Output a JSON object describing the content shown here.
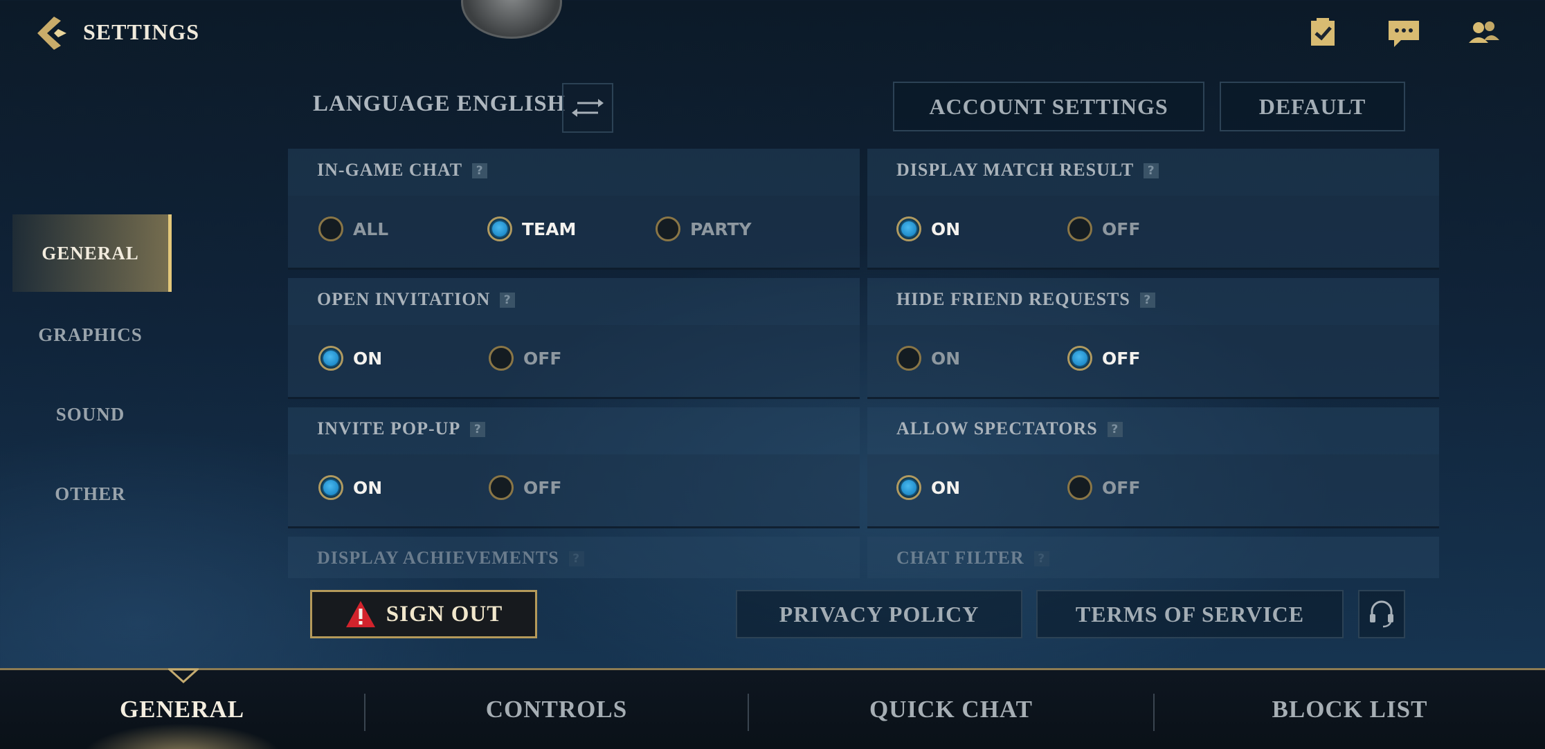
{
  "header": {
    "title": "SETTINGS"
  },
  "language": {
    "label": "LANGUAGE ENGLISH"
  },
  "actions": {
    "account_settings": "ACCOUNT SETTINGS",
    "default": "DEFAULT"
  },
  "sidebar": {
    "items": [
      {
        "label": "GENERAL",
        "active": true
      },
      {
        "label": "GRAPHICS"
      },
      {
        "label": "SOUND"
      },
      {
        "label": "OTHER"
      }
    ]
  },
  "settings": {
    "in_game_chat": {
      "title": "IN-GAME CHAT",
      "options": [
        "ALL",
        "TEAM",
        "PARTY"
      ],
      "selected": "TEAM"
    },
    "display_match_result": {
      "title": "DISPLAY MATCH RESULT",
      "options": [
        "ON",
        "OFF"
      ],
      "selected": "ON"
    },
    "open_invitation": {
      "title": "OPEN INVITATION",
      "options": [
        "ON",
        "OFF"
      ],
      "selected": "ON"
    },
    "hide_friend_requests": {
      "title": "HIDE FRIEND REQUESTS",
      "options": [
        "ON",
        "OFF"
      ],
      "selected": "OFF"
    },
    "invite_popup": {
      "title": "INVITE POP-UP",
      "options": [
        "ON",
        "OFF"
      ],
      "selected": "ON"
    },
    "allow_spectators": {
      "title": "ALLOW SPECTATORS",
      "options": [
        "ON",
        "OFF"
      ],
      "selected": "ON"
    },
    "display_achievements": {
      "title": "DISPLAY ACHIEVEMENTS"
    },
    "chat_filter": {
      "title": "CHAT FILTER"
    },
    "help_glyph": "?"
  },
  "footer": {
    "sign_out": "SIGN OUT",
    "privacy_policy": "PRIVACY POLICY",
    "terms_of_service": "TERMS OF SERVICE"
  },
  "tabs": [
    {
      "label": "GENERAL",
      "active": true
    },
    {
      "label": "CONTROLS"
    },
    {
      "label": "QUICK CHAT"
    },
    {
      "label": "BLOCK LIST"
    }
  ],
  "colors": {
    "accent_gold": "#c8aa6e",
    "radio_on": "#1e9be0"
  }
}
